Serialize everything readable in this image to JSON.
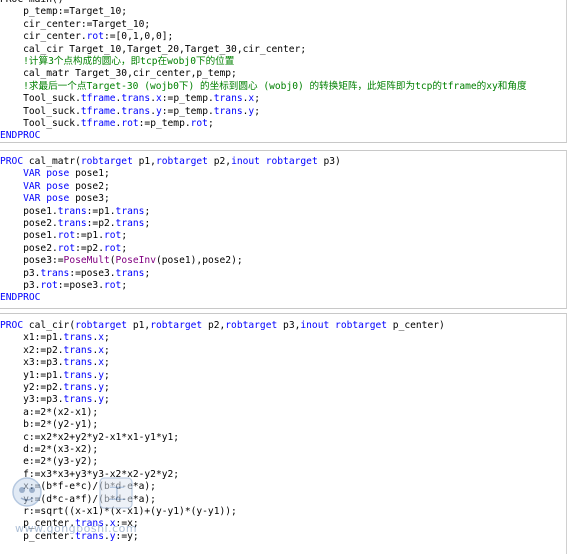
{
  "code": {
    "block1": [
      [
        [
          "p",
          "PROC main()"
        ]
      ],
      [
        [
          "p",
          "    p_temp:=Target_10;"
        ]
      ],
      [
        [
          "p",
          "    cir_center:=Target_10;"
        ]
      ],
      [
        [
          "p",
          "    cir_center."
        ],
        [
          "t",
          "rot"
        ],
        [
          "p",
          ":=[0,1,0,0];"
        ]
      ],
      [
        [
          "p",
          "    cal_cir Target_10,Target_20,Target_30,cir_center;"
        ]
      ],
      [
        [
          "c",
          "    !计算3个点构成的圆心，即tcp在wobj0下的位置"
        ]
      ],
      [
        [
          "p",
          "    cal_matr Target_30,cir_center,p_temp;"
        ]
      ],
      [
        [
          "c",
          "    !求最后一个点Target-30 (wojb0下) 的坐标到圆心 (wobj0) 的转换矩阵，此矩阵即为tcp的tframe的xy和角度"
        ]
      ],
      [
        [
          "p",
          "    Tool_suck."
        ],
        [
          "t",
          "tframe"
        ],
        [
          "p",
          "."
        ],
        [
          "t",
          "trans"
        ],
        [
          "p",
          "."
        ],
        [
          "t",
          "x"
        ],
        [
          "p",
          ":=p_temp."
        ],
        [
          "t",
          "trans"
        ],
        [
          "p",
          "."
        ],
        [
          "t",
          "x"
        ],
        [
          "p",
          ";"
        ]
      ],
      [
        [
          "p",
          "    Tool_suck."
        ],
        [
          "t",
          "tframe"
        ],
        [
          "p",
          "."
        ],
        [
          "t",
          "trans"
        ],
        [
          "p",
          "."
        ],
        [
          "t",
          "y"
        ],
        [
          "p",
          ":=p_temp."
        ],
        [
          "t",
          "trans"
        ],
        [
          "p",
          "."
        ],
        [
          "t",
          "y"
        ],
        [
          "p",
          ";"
        ]
      ],
      [
        [
          "p",
          "    Tool_suck."
        ],
        [
          "t",
          "tframe"
        ],
        [
          "p",
          "."
        ],
        [
          "t",
          "rot"
        ],
        [
          "p",
          ":=p_temp."
        ],
        [
          "t",
          "rot"
        ],
        [
          "p",
          ";"
        ]
      ],
      [
        [
          "k",
          "ENDPROC"
        ]
      ]
    ],
    "block2": [
      [
        [
          "k",
          "PROC"
        ],
        [
          "p",
          " cal_matr("
        ],
        [
          "t",
          "robtarget"
        ],
        [
          "p",
          " p1,"
        ],
        [
          "t",
          "robtarget"
        ],
        [
          "p",
          " p2,"
        ],
        [
          "k",
          "inout"
        ],
        [
          "p",
          " "
        ],
        [
          "t",
          "robtarget"
        ],
        [
          "p",
          " p3)"
        ]
      ],
      [
        [
          "p",
          "    "
        ],
        [
          "k",
          "VAR"
        ],
        [
          "p",
          " "
        ],
        [
          "t",
          "pose"
        ],
        [
          "p",
          " pose1;"
        ]
      ],
      [
        [
          "p",
          "    "
        ],
        [
          "k",
          "VAR"
        ],
        [
          "p",
          " "
        ],
        [
          "t",
          "pose"
        ],
        [
          "p",
          " pose2;"
        ]
      ],
      [
        [
          "p",
          "    "
        ],
        [
          "k",
          "VAR"
        ],
        [
          "p",
          " "
        ],
        [
          "t",
          "pose"
        ],
        [
          "p",
          " pose3;"
        ]
      ],
      [
        [
          "p",
          "    pose1."
        ],
        [
          "t",
          "trans"
        ],
        [
          "p",
          ":=p1."
        ],
        [
          "t",
          "trans"
        ],
        [
          "p",
          ";"
        ]
      ],
      [
        [
          "p",
          "    pose2."
        ],
        [
          "t",
          "trans"
        ],
        [
          "p",
          ":=p2."
        ],
        [
          "t",
          "trans"
        ],
        [
          "p",
          ";"
        ]
      ],
      [
        [
          "p",
          "    pose1."
        ],
        [
          "t",
          "rot"
        ],
        [
          "p",
          ":=p1."
        ],
        [
          "t",
          "rot"
        ],
        [
          "p",
          ";"
        ]
      ],
      [
        [
          "p",
          "    pose2."
        ],
        [
          "t",
          "rot"
        ],
        [
          "p",
          ":=p2."
        ],
        [
          "t",
          "rot"
        ],
        [
          "p",
          ";"
        ]
      ],
      [
        [
          "p",
          "    pose3:="
        ],
        [
          "f",
          "PoseMult"
        ],
        [
          "p",
          "("
        ],
        [
          "f",
          "PoseInv"
        ],
        [
          "p",
          "(pose1),pose2);"
        ]
      ],
      [
        [
          "p",
          "    p3."
        ],
        [
          "t",
          "trans"
        ],
        [
          "p",
          ":=pose3."
        ],
        [
          "t",
          "trans"
        ],
        [
          "p",
          ";"
        ]
      ],
      [
        [
          "p",
          "    p3."
        ],
        [
          "t",
          "rot"
        ],
        [
          "p",
          ":=pose3."
        ],
        [
          "t",
          "rot"
        ],
        [
          "p",
          ";"
        ]
      ],
      [
        [
          "k",
          "ENDPROC"
        ]
      ]
    ],
    "block3": [
      [
        [
          "k",
          "PROC"
        ],
        [
          "p",
          " cal_cir("
        ],
        [
          "t",
          "robtarget"
        ],
        [
          "p",
          " p1,"
        ],
        [
          "t",
          "robtarget"
        ],
        [
          "p",
          " p2,"
        ],
        [
          "t",
          "robtarget"
        ],
        [
          "p",
          " p3,"
        ],
        [
          "k",
          "inout"
        ],
        [
          "p",
          " "
        ],
        [
          "t",
          "robtarget"
        ],
        [
          "p",
          " p_center)"
        ]
      ],
      [
        [
          "p",
          "    x1:=p1."
        ],
        [
          "t",
          "trans"
        ],
        [
          "p",
          "."
        ],
        [
          "t",
          "x"
        ],
        [
          "p",
          ";"
        ]
      ],
      [
        [
          "p",
          "    x2:=p2."
        ],
        [
          "t",
          "trans"
        ],
        [
          "p",
          "."
        ],
        [
          "t",
          "x"
        ],
        [
          "p",
          ";"
        ]
      ],
      [
        [
          "p",
          "    x3:=p3."
        ],
        [
          "t",
          "trans"
        ],
        [
          "p",
          "."
        ],
        [
          "t",
          "x"
        ],
        [
          "p",
          ";"
        ]
      ],
      [
        [
          "p",
          "    y1:=p1."
        ],
        [
          "t",
          "trans"
        ],
        [
          "p",
          "."
        ],
        [
          "t",
          "y"
        ],
        [
          "p",
          ";"
        ]
      ],
      [
        [
          "p",
          "    y2:=p2."
        ],
        [
          "t",
          "trans"
        ],
        [
          "p",
          "."
        ],
        [
          "t",
          "y"
        ],
        [
          "p",
          ";"
        ]
      ],
      [
        [
          "p",
          "    y3:=p3."
        ],
        [
          "t",
          "trans"
        ],
        [
          "p",
          "."
        ],
        [
          "t",
          "y"
        ],
        [
          "p",
          ";"
        ]
      ],
      [
        [
          "p",
          "    a:=2*(x2-x1);"
        ]
      ],
      [
        [
          "p",
          "    b:=2*(y2-y1);"
        ]
      ],
      [
        [
          "p",
          "    c:=x2*x2+y2*y2-x1*x1-y1*y1;"
        ]
      ],
      [
        [
          "p",
          "    d:=2*(x3-x2);"
        ]
      ],
      [
        [
          "p",
          "    e:=2*(y3-y2);"
        ]
      ],
      [
        [
          "p",
          "    f:=x3*x3+y3*y3-x2*x2-y2*y2;"
        ]
      ],
      [
        [
          "p",
          "    x:=(b*f-e*c)/(b*d-e*a);"
        ]
      ],
      [
        [
          "p",
          "    y:=(d*c-a*f)/(b*d-e*a);"
        ]
      ],
      [
        [
          "p",
          "    r:=sqrt((x-x1)*(x-x1)+(y-y1)*(y-y1));"
        ]
      ],
      [
        [
          "p",
          "    p_center."
        ],
        [
          "t",
          "trans"
        ],
        [
          "p",
          "."
        ],
        [
          "t",
          "x"
        ],
        [
          "p",
          ":=x;"
        ]
      ],
      [
        [
          "p",
          "    p_center."
        ],
        [
          "t",
          "trans"
        ],
        [
          "p",
          "."
        ],
        [
          "t",
          "y"
        ],
        [
          "p",
          ":=y;"
        ]
      ]
    ]
  },
  "watermark": {
    "text": "www.gongboshi.com",
    "icon": "robot-mascot-icon"
  }
}
